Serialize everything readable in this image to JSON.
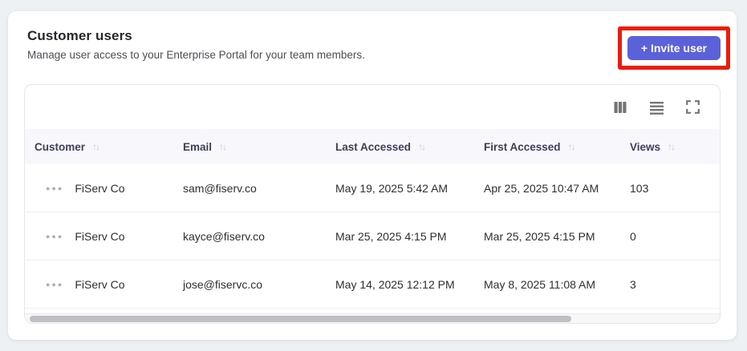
{
  "page": {
    "title": "Customer users",
    "subtitle": "Manage user access to your Enterprise Portal for your team members."
  },
  "actions": {
    "invite_label": "+ Invite user"
  },
  "colors": {
    "accent": "#5b61d9",
    "annotation_highlight": "#ea1c0d",
    "page_background": "#edf1f4",
    "header_row_background": "#f8f8fc"
  },
  "toolbar": {
    "icons": [
      "columns-icon",
      "density-icon",
      "fullscreen-icon"
    ]
  },
  "table": {
    "sort_icon": "↑↓",
    "row_menu_icon": "●●●",
    "columns": [
      {
        "label": "Customer"
      },
      {
        "label": "Email"
      },
      {
        "label": "Last Accessed"
      },
      {
        "label": "First Accessed"
      },
      {
        "label": "Views"
      }
    ],
    "rows": [
      {
        "customer": "FiServ Co",
        "email": "sam@fiserv.co",
        "last_accessed": "May 19, 2025 5:42 AM",
        "first_accessed": "Apr 25, 2025 10:47 AM",
        "views": "103"
      },
      {
        "customer": "FiServ Co",
        "email": "kayce@fiserv.co",
        "last_accessed": "Mar 25, 2025 4:15 PM",
        "first_accessed": "Mar 25, 2025 4:15 PM",
        "views": "0"
      },
      {
        "customer": "FiServ Co",
        "email": "jose@fiservc.co",
        "last_accessed": "May 14, 2025 12:12 PM",
        "first_accessed": "May 8, 2025 11:08 AM",
        "views": "3"
      }
    ]
  }
}
